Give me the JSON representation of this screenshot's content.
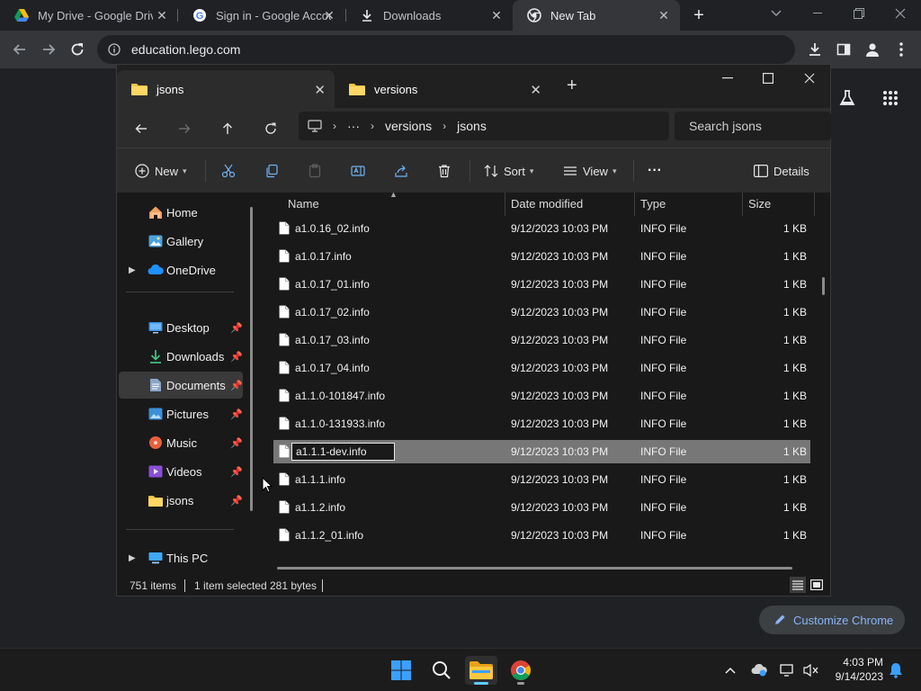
{
  "browser": {
    "tabs": [
      {
        "title": "My Drive - Google Drive",
        "icon": "google-drive-icon"
      },
      {
        "title": "Sign in - Google Accounts",
        "icon": "google-icon"
      },
      {
        "title": "Downloads",
        "icon": "download-icon"
      },
      {
        "title": "New Tab",
        "icon": "chrome-icon",
        "active": true
      }
    ],
    "url": "education.lego.com",
    "customize_label": "Customize Chrome"
  },
  "explorer": {
    "tabs": [
      {
        "label": "jsons",
        "active": true
      },
      {
        "label": "versions",
        "active": false
      }
    ],
    "breadcrumb": [
      "···",
      "versions",
      "jsons"
    ],
    "search_placeholder": "Search jsons",
    "commands": {
      "new": "New",
      "sort": "Sort",
      "view": "View",
      "more": "···",
      "details": "Details"
    },
    "nav": {
      "home": "Home",
      "gallery": "Gallery",
      "onedrive": "OneDrive",
      "desktop": "Desktop",
      "downloads": "Downloads",
      "documents": "Documents",
      "pictures": "Pictures",
      "music": "Music",
      "videos": "Videos",
      "jsons": "jsons",
      "thispc": "This PC"
    },
    "columns": {
      "name": "Name",
      "date": "Date modified",
      "type": "Type",
      "size": "Size"
    },
    "files": [
      {
        "name": "a1.0.16_02.info",
        "date": "9/12/2023 10:03 PM",
        "type": "INFO File",
        "size": "1 KB"
      },
      {
        "name": "a1.0.17.info",
        "date": "9/12/2023 10:03 PM",
        "type": "INFO File",
        "size": "1 KB"
      },
      {
        "name": "a1.0.17_01.info",
        "date": "9/12/2023 10:03 PM",
        "type": "INFO File",
        "size": "1 KB"
      },
      {
        "name": "a1.0.17_02.info",
        "date": "9/12/2023 10:03 PM",
        "type": "INFO File",
        "size": "1 KB"
      },
      {
        "name": "a1.0.17_03.info",
        "date": "9/12/2023 10:03 PM",
        "type": "INFO File",
        "size": "1 KB"
      },
      {
        "name": "a1.0.17_04.info",
        "date": "9/12/2023 10:03 PM",
        "type": "INFO File",
        "size": "1 KB"
      },
      {
        "name": "a1.1.0-101847.info",
        "date": "9/12/2023 10:03 PM",
        "type": "INFO File",
        "size": "1 KB"
      },
      {
        "name": "a1.1.0-131933.info",
        "date": "9/12/2023 10:03 PM",
        "type": "INFO File",
        "size": "1 KB"
      },
      {
        "name": "a1.1.1-dev.info",
        "date": "9/12/2023 10:03 PM",
        "type": "INFO File",
        "size": "1 KB",
        "selected": true,
        "renaming": true
      },
      {
        "name": "a1.1.1.info",
        "date": "9/12/2023 10:03 PM",
        "type": "INFO File",
        "size": "1 KB"
      },
      {
        "name": "a1.1.2.info",
        "date": "9/12/2023 10:03 PM",
        "type": "INFO File",
        "size": "1 KB"
      },
      {
        "name": "a1.1.2_01.info",
        "date": "9/12/2023 10:03 PM",
        "type": "INFO File",
        "size": "1 KB"
      }
    ],
    "status": {
      "count": "751 items",
      "selected": "1 item selected",
      "size": "281 bytes"
    }
  },
  "taskbar": {
    "time": "4:03 PM",
    "date": "9/14/2023"
  },
  "colors": {
    "accent": "#60cdff",
    "link": "#8ab4f8",
    "selected_row": "#777777"
  }
}
